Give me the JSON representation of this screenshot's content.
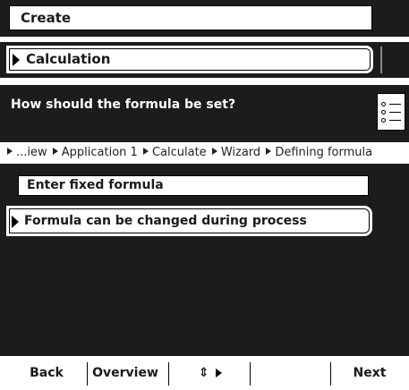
{
  "menu": {
    "create_label": "Create",
    "calculation_label": "Calculation"
  },
  "dialog": {
    "question": "How should the formula be set?",
    "breadcrumb": [
      "...iew",
      "Application 1",
      "Calculate",
      "Wizard",
      "Defining formula"
    ],
    "options": [
      {
        "label": "Enter fixed formula",
        "selected": false
      },
      {
        "label": "Formula can be changed during process",
        "selected": true
      }
    ]
  },
  "softkeys": {
    "back": "Back",
    "overview": "Overview",
    "updown_glyph": "⇕",
    "next": "Next"
  },
  "colors": {
    "panel_bg": "#1c1c1c",
    "highlight_bg": "#ffffff",
    "text": "#1a1a1a"
  }
}
